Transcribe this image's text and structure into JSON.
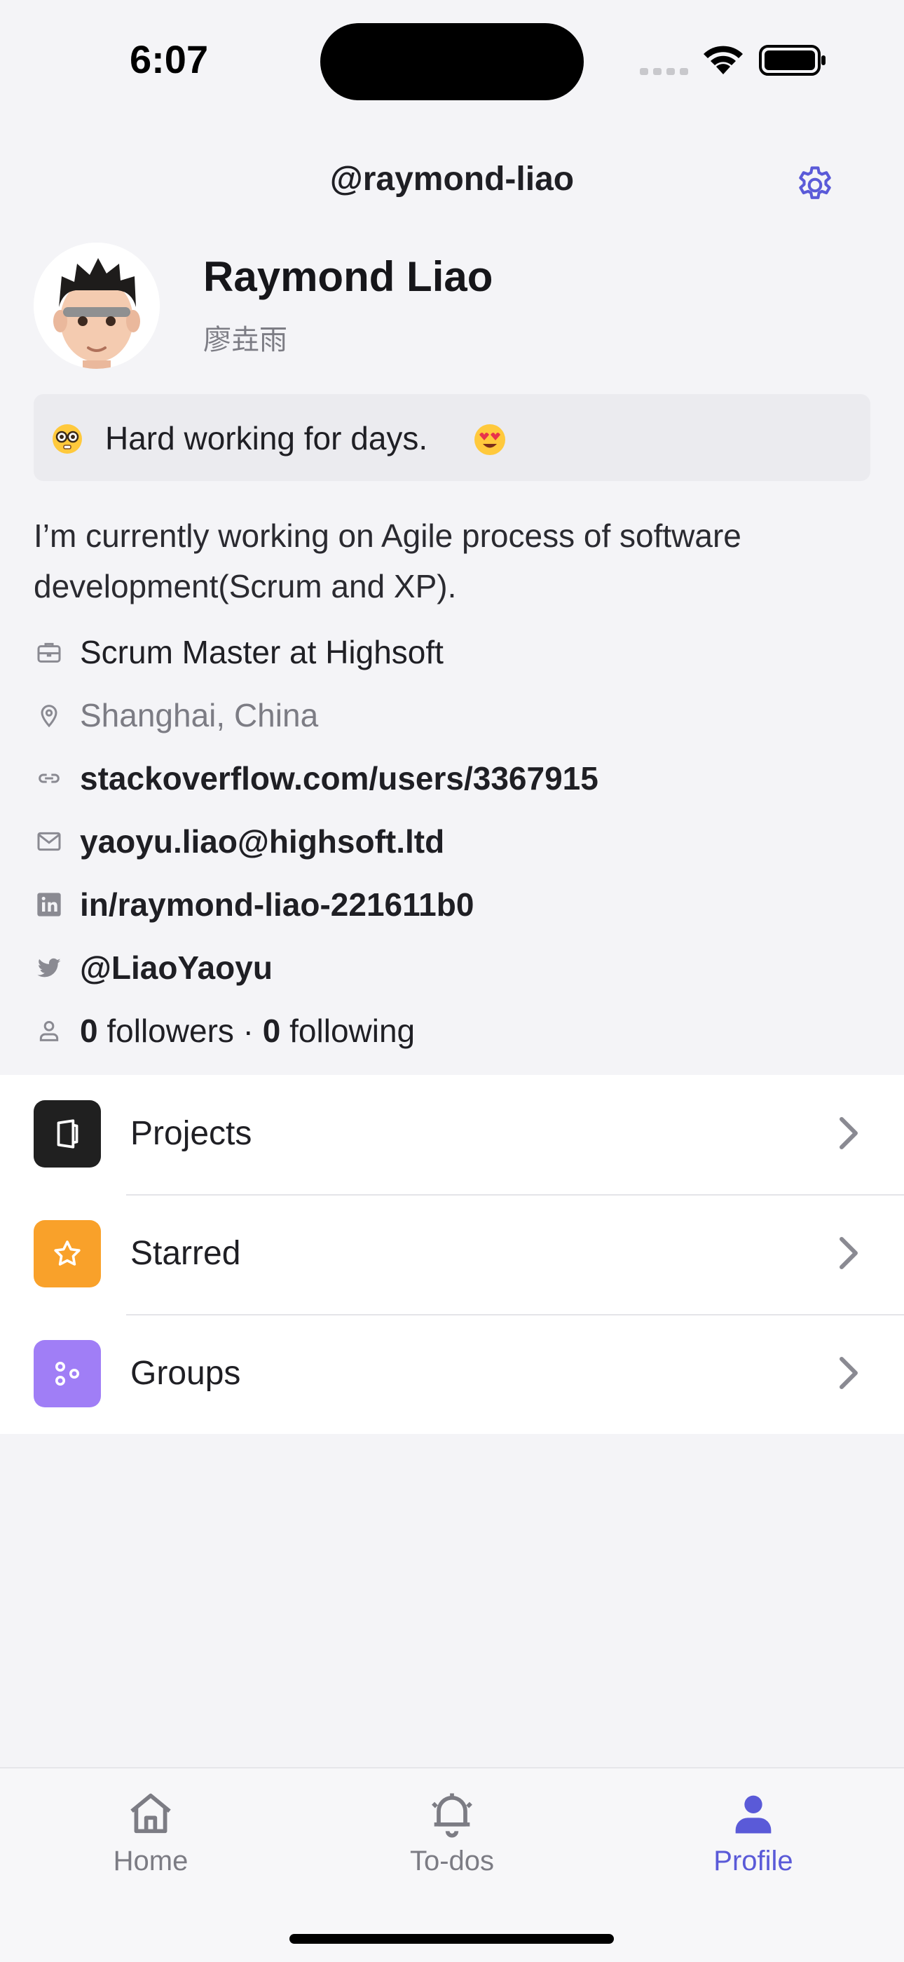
{
  "status_bar": {
    "time": "6:07"
  },
  "header": {
    "username": "@raymond-liao",
    "settings_icon": "gear-icon"
  },
  "profile": {
    "name": "Raymond Liao",
    "alias": "廖垚雨",
    "status": "Hard working for days.",
    "bio": "I’m currently working on Agile process of software development(Scrum and XP).",
    "job": "Scrum Master at Highsoft",
    "location": "Shanghai, China",
    "website": "stackoverflow.com/users/3367915",
    "email": "yaoyu.liao@highsoft.ltd",
    "linkedin": "in/raymond-liao-221611b0",
    "twitter": "@LiaoYaoyu",
    "followers_count": "0",
    "followers_label": "followers ·",
    "following_count": "0",
    "following_label": "following"
  },
  "menu": [
    {
      "label": "Projects",
      "icon": "projects-icon",
      "color": "#202020"
    },
    {
      "label": "Starred",
      "icon": "star-icon",
      "color": "#f9a12a"
    },
    {
      "label": "Groups",
      "icon": "groups-icon",
      "color": "#a07ef6"
    }
  ],
  "tabs": [
    {
      "label": "Home",
      "icon": "home-icon",
      "active": false
    },
    {
      "label": "To-dos",
      "icon": "bell-icon",
      "active": false
    },
    {
      "label": "Profile",
      "icon": "person-icon",
      "active": true
    }
  ],
  "colors": {
    "accent": "#5a5ad8",
    "inactive": "#7c7c84"
  }
}
